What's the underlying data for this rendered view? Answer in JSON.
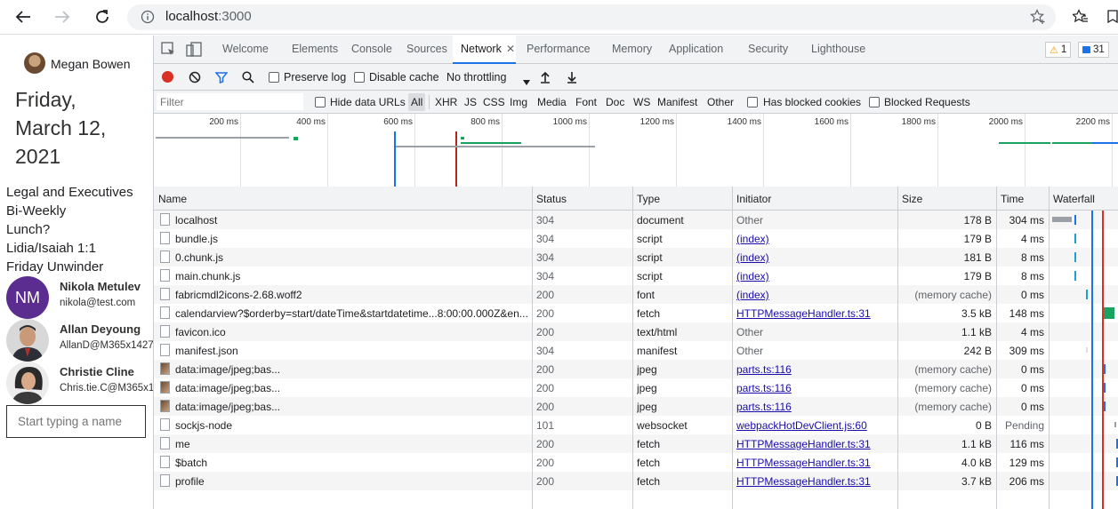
{
  "browser": {
    "url_host": "localhost",
    "url_port": ":3000"
  },
  "app": {
    "me_name": "Megan Bowen",
    "date": "Friday, March 12, 2021",
    "date_lines": [
      "Friday,",
      "March 12,",
      "2021"
    ],
    "events": [
      "Legal and Executives",
      "Bi-Weekly",
      "Lunch?",
      "Lidia/Isaiah 1:1",
      "Friday Unwinder"
    ],
    "people": [
      {
        "initials": "NM",
        "name": "Nikola Metulev",
        "email": "nikola@test.com"
      },
      {
        "initials": "",
        "name": "Allan Deyoung",
        "email": "AllanD@M365x1427"
      },
      {
        "initials": "",
        "name": "Christie Cline",
        "email": "Chris.tie.C@M365x1"
      }
    ],
    "people_picker_placeholder": "Start typing a name",
    "avatar_color_nm": "#5c2d91"
  },
  "devtools": {
    "tabs": [
      "Welcome",
      "Elements",
      "Console",
      "Sources",
      "Network",
      "Performance",
      "Memory",
      "Application",
      "Security",
      "Lighthouse"
    ],
    "active_tab": "Network",
    "warnings_count": "1",
    "messages_count": "31",
    "toolbar": {
      "preserve_log": "Preserve log",
      "disable_cache": "Disable cache",
      "throttling": "No throttling"
    },
    "filter": {
      "placeholder": "Filter",
      "hide_data_urls": "Hide data URLs",
      "types": [
        "All",
        "XHR",
        "JS",
        "CSS",
        "Img",
        "Media",
        "Font",
        "Doc",
        "WS",
        "Manifest",
        "Other"
      ],
      "has_blocked_cookies": "Has blocked cookies",
      "blocked_requests": "Blocked Requests"
    },
    "overview_ticks": [
      "200 ms",
      "400 ms",
      "600 ms",
      "800 ms",
      "1000 ms",
      "1200 ms",
      "1400 ms",
      "1600 ms",
      "1800 ms",
      "2000 ms",
      "2200 ms"
    ],
    "columns": [
      "Name",
      "Status",
      "Type",
      "Initiator",
      "Size",
      "Time",
      "Waterfall"
    ],
    "rows": [
      {
        "name": "localhost",
        "status": "304",
        "type": "document",
        "initiator": "Other",
        "initiator_link": false,
        "size": "178 B",
        "time": "304 ms"
      },
      {
        "name": "bundle.js",
        "status": "304",
        "type": "script",
        "initiator": "(index)",
        "initiator_link": true,
        "size": "179 B",
        "time": "4 ms"
      },
      {
        "name": "0.chunk.js",
        "status": "304",
        "type": "script",
        "initiator": "(index)",
        "initiator_link": true,
        "size": "181 B",
        "time": "8 ms"
      },
      {
        "name": "main.chunk.js",
        "status": "304",
        "type": "script",
        "initiator": "(index)",
        "initiator_link": true,
        "size": "179 B",
        "time": "8 ms"
      },
      {
        "name": "fabricmdl2icons-2.68.woff2",
        "status": "200",
        "type": "font",
        "initiator": "(index)",
        "initiator_link": true,
        "size": "(memory cache)",
        "time": "0 ms"
      },
      {
        "name": "calendarview?$orderby=start/dateTime&startdatetime...8:00:00.000Z&en...",
        "status": "200",
        "type": "fetch",
        "initiator": "HTTPMessageHandler.ts:31",
        "initiator_link": true,
        "size": "3.5 kB",
        "time": "148 ms"
      },
      {
        "name": "favicon.ico",
        "status": "200",
        "type": "text/html",
        "initiator": "Other",
        "initiator_link": false,
        "size": "1.1 kB",
        "time": "4 ms"
      },
      {
        "name": "manifest.json",
        "status": "304",
        "type": "manifest",
        "initiator": "Other",
        "initiator_link": false,
        "size": "242 B",
        "time": "309 ms"
      },
      {
        "name": "data:image/jpeg;bas...",
        "status": "200",
        "type": "jpeg",
        "initiator": "parts.ts:116",
        "initiator_link": true,
        "size": "(memory cache)",
        "time": "0 ms"
      },
      {
        "name": "data:image/jpeg;bas...",
        "status": "200",
        "type": "jpeg",
        "initiator": "parts.ts:116",
        "initiator_link": true,
        "size": "(memory cache)",
        "time": "0 ms"
      },
      {
        "name": "data:image/jpeg;bas...",
        "status": "200",
        "type": "jpeg",
        "initiator": "parts.ts:116",
        "initiator_link": true,
        "size": "(memory cache)",
        "time": "0 ms"
      },
      {
        "name": "sockjs-node",
        "status": "101",
        "type": "websocket",
        "initiator": "webpackHotDevClient.js:60",
        "initiator_link": true,
        "size": "0 B",
        "time": "Pending"
      },
      {
        "name": "me",
        "status": "200",
        "type": "fetch",
        "initiator": "HTTPMessageHandler.ts:31",
        "initiator_link": true,
        "size": "1.1 kB",
        "time": "116 ms"
      },
      {
        "name": "$batch",
        "status": "200",
        "type": "fetch",
        "initiator": "HTTPMessageHandler.ts:31",
        "initiator_link": true,
        "size": "4.0 kB",
        "time": "129 ms"
      },
      {
        "name": "profile",
        "status": "200",
        "type": "fetch",
        "initiator": "HTTPMessageHandler.ts:31",
        "initiator_link": true,
        "size": "3.7 kB",
        "time": "206 ms"
      }
    ]
  }
}
